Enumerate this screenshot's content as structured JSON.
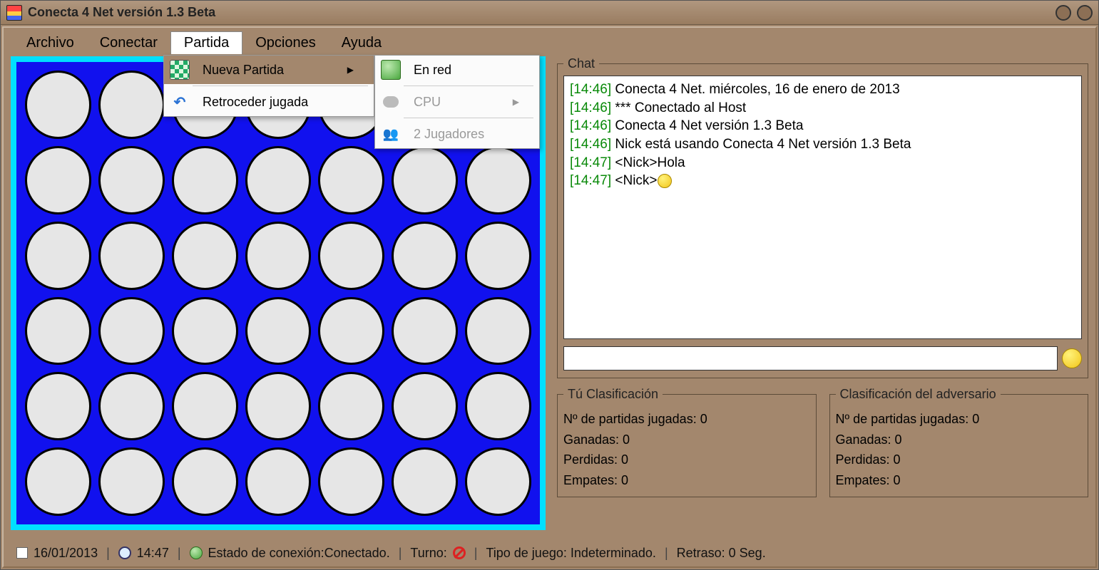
{
  "title": "Conecta 4 Net versión 1.3 Beta",
  "menubar": [
    "Archivo",
    "Conectar",
    "Partida",
    "Opciones",
    "Ayuda"
  ],
  "active_menu_index": 2,
  "dropdown": {
    "items": [
      {
        "label": "Nueva Partida",
        "icon": "checker",
        "submenu": true,
        "highlighted": true
      },
      {
        "label": "Retroceder jugada",
        "icon": "undo"
      }
    ]
  },
  "submenu": {
    "items": [
      {
        "label": "En red",
        "icon": "globe",
        "disabled": false
      },
      {
        "label": "CPU",
        "icon": "cloud",
        "disabled": true,
        "submenu": true
      },
      {
        "label": "2 Jugadores",
        "icon": "people",
        "disabled": true
      }
    ]
  },
  "board": {
    "cols": 7,
    "rows": 6
  },
  "chat": {
    "legend": "Chat",
    "messages": [
      {
        "time": "[14:46]",
        "text": " Conecta 4 Net. miércoles, 16 de enero de 2013"
      },
      {
        "time": "[14:46]",
        "text": " *** Conectado al Host"
      },
      {
        "time": "[14:46]",
        "text": " Conecta 4 Net versión 1.3 Beta"
      },
      {
        "time": "[14:46]",
        "text": " Nick está usando Conecta 4 Net versión 1.3 Beta"
      },
      {
        "time": "[14:47]",
        "text": " <Nick>Hola"
      },
      {
        "time": "[14:47]",
        "text": " <Nick>",
        "emoji": true
      }
    ],
    "input_value": ""
  },
  "score_you": {
    "legend": "Tú Clasificación",
    "lines": [
      "Nº de partidas jugadas: 0",
      "Ganadas: 0",
      "Perdidas: 0",
      "Empates: 0"
    ]
  },
  "score_opp": {
    "legend": "Clasificación del adversario",
    "lines": [
      "Nº de partidas jugadas: 0",
      "Ganadas: 0",
      "Perdidas: 0",
      "Empates: 0"
    ]
  },
  "statusbar": {
    "date": "16/01/2013",
    "time": "14:47",
    "conn": "Estado de conexión:Conectado.",
    "turn_label": "Turno:",
    "game_type": "Tipo de juego: Indeterminado.",
    "delay": "Retraso: 0 Seg."
  }
}
